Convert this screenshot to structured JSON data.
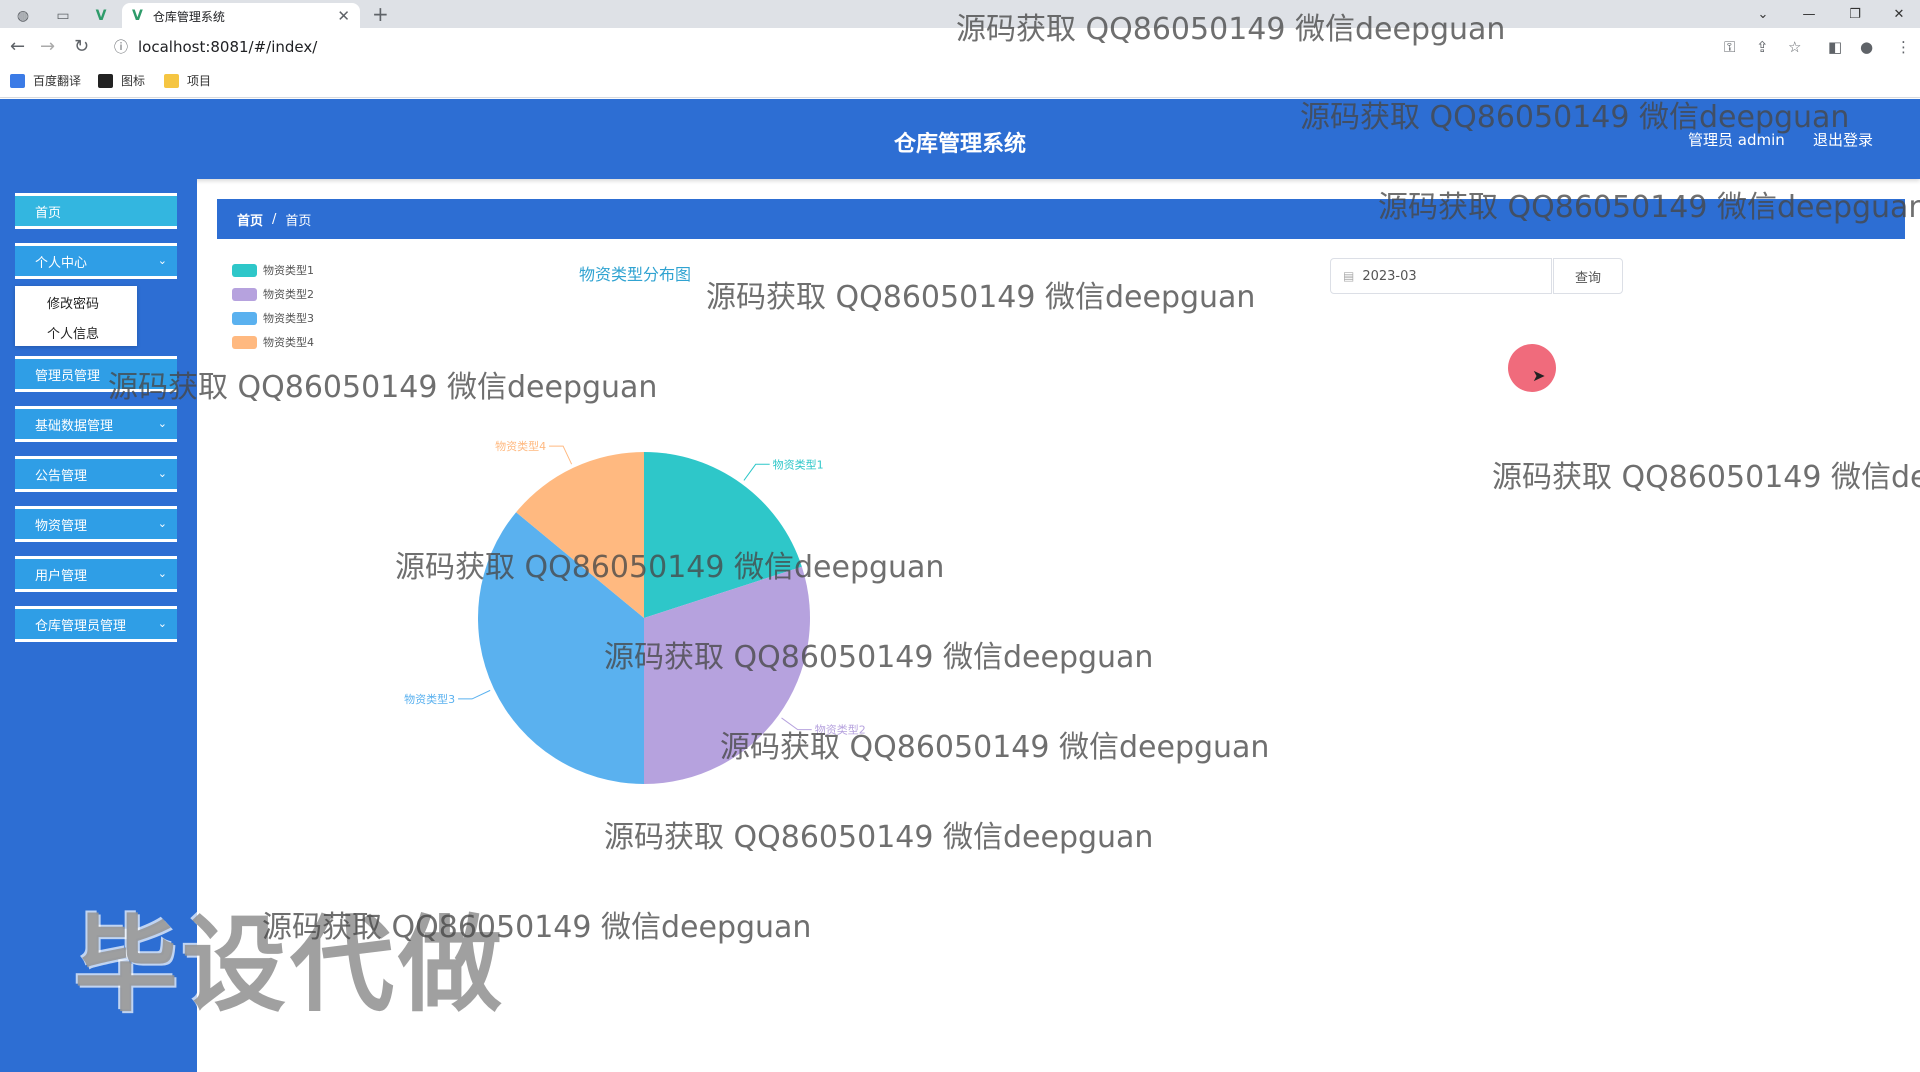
{
  "browser": {
    "tab_title": "仓库管理系统",
    "url": "localhost:8081/#/index/",
    "bookmarks": [
      "百度翻译",
      "图标",
      "项目"
    ]
  },
  "header": {
    "title": "仓库管理系统",
    "user_label": "管理员 admin",
    "logout_label": "退出登录"
  },
  "sidebar": {
    "items": [
      {
        "label": "首页"
      },
      {
        "label": "个人中心"
      },
      {
        "label": "管理员管理"
      },
      {
        "label": "基础数据管理"
      },
      {
        "label": "公告管理"
      },
      {
        "label": "物资管理"
      },
      {
        "label": "用户管理"
      },
      {
        "label": "仓库管理员管理"
      }
    ],
    "submenu": [
      {
        "label": "修改密码"
      },
      {
        "label": "个人信息"
      }
    ]
  },
  "breadcrumb": [
    "首页",
    "首页"
  ],
  "filter": {
    "date_value": "2023-03",
    "query_label": "查询"
  },
  "chart_data": {
    "type": "pie",
    "title": "物资类型分布图",
    "legend_position": "top-left",
    "labels": [
      "物资类型1",
      "物资类型2",
      "物资类型3",
      "物资类型4"
    ],
    "values": [
      20,
      30,
      36,
      14
    ],
    "colors": [
      "#2ec7c9",
      "#b6a2de",
      "#5ab1ef",
      "#ffb980"
    ]
  },
  "watermark_text": "源码获取 QQ86050149 微信deepguan",
  "stamp_text": "毕设代做"
}
